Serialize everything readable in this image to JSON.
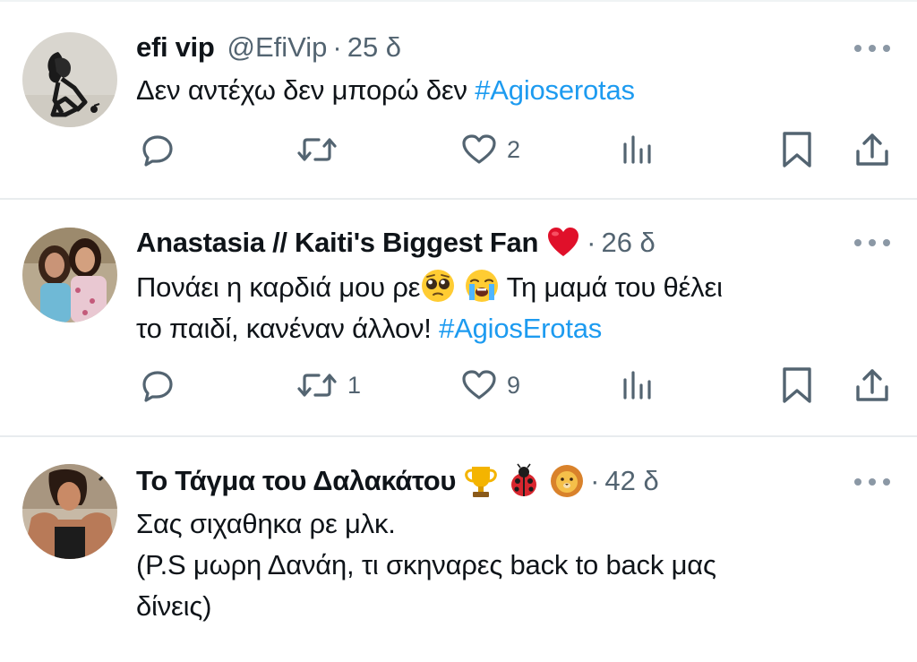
{
  "colors": {
    "text": "#0f1419",
    "secondary": "#536471",
    "hashtag": "#1d9bf0",
    "divider": "#e8ecee",
    "heart_emoji": "#e0102a"
  },
  "tweets": [
    {
      "name": "efi vip",
      "handle": "@EfiVip",
      "dot": "·",
      "time": "25 δ",
      "text_before": "Δεν αντέχω δεν μπορώ δεν ",
      "hashtag": "#Agioserotas",
      "actions": {
        "reply_count": "",
        "retweet_count": "",
        "like_count": "2",
        "views_count": ""
      },
      "icons": [
        "reply-icon",
        "retweet-icon",
        "heart-icon",
        "views-icon",
        "bookmark-icon",
        "share-icon"
      ]
    },
    {
      "name": "Anastasia // Kaiti's Biggest Fan",
      "dot": "·",
      "time": "26 δ",
      "text_line1_before": "Πονάει η καρδιά μου ρε",
      "text_line1_after": " Τη μαμά του θέλει",
      "text_line2": "το παιδί, κανέναν άλλον! ",
      "hashtag": "#AgiosErotas",
      "actions": {
        "reply_count": "",
        "retweet_count": "1",
        "like_count": "9",
        "views_count": ""
      },
      "emojis": [
        "red-heart-emoji",
        "pleading-face-emoji",
        "loudly-crying-face-emoji"
      ]
    },
    {
      "name": "Το Τάγμα του Δαλακάτου",
      "dot": "·",
      "time": "42 δ",
      "text_line1": "Σας σιχαθηκα ρε μλκ.",
      "text_line2": "(P.S μωρη Δανάη, τι σκηναρες back to back μας",
      "text_line3": "δίνεις)",
      "emojis": [
        "trophy-emoji",
        "lady-beetle-emoji",
        "lion-face-emoji"
      ]
    }
  ]
}
